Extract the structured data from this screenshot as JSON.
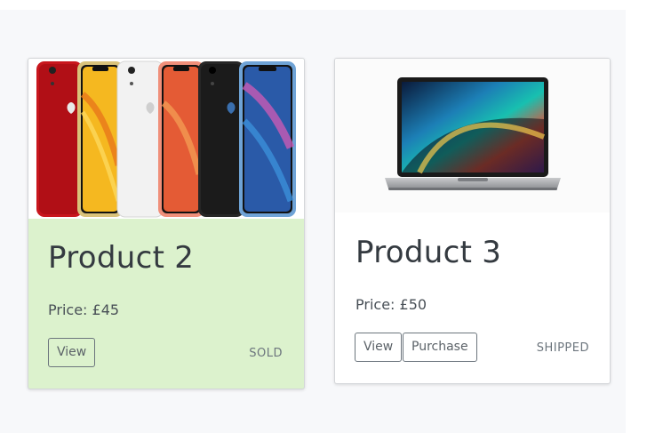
{
  "products": [
    {
      "image_icon": "iphone-xr-lineup-image",
      "title": "Product 2",
      "price": "Price: £45",
      "view_label": "View",
      "status": "SOLD",
      "background": "#dcf2cd"
    },
    {
      "image_icon": "macbook-pro-image",
      "title": "Product 3",
      "price": "Price: £50",
      "view_label": "View",
      "purchase_label": "Purchase",
      "status": "SHIPPED",
      "background": "#ffffff"
    }
  ],
  "colors": {
    "page_background": "#f7f8fa",
    "sold_card": "#dcf2cd",
    "button_border": "#6c757d",
    "text": "#343a40"
  }
}
